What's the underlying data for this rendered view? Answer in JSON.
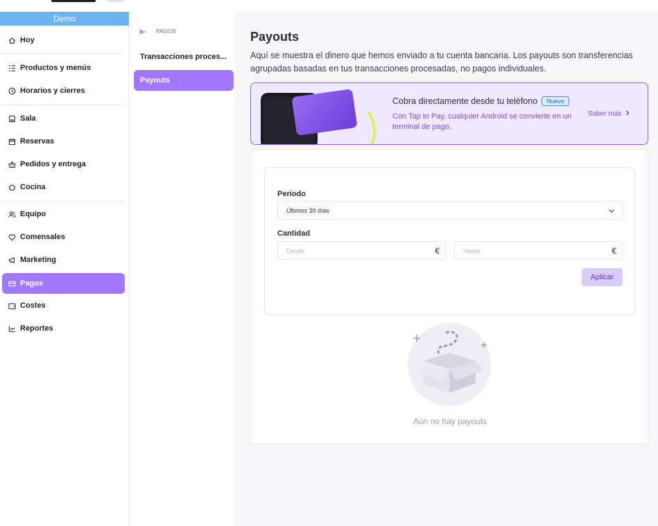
{
  "workspace": {
    "name": "Demo"
  },
  "sidebar": {
    "items": [
      {
        "label": "Hoy",
        "icon": "home-icon"
      },
      {
        "label": "Productos y menús",
        "icon": "list-icon"
      },
      {
        "label": "Horarios y cierres",
        "icon": "clock-icon"
      },
      {
        "label": "Sala",
        "icon": "store-icon"
      },
      {
        "label": "Reservas",
        "icon": "calendar-icon"
      },
      {
        "label": "Pedidos y entrega",
        "icon": "basket-icon"
      },
      {
        "label": "Cocina",
        "icon": "chef-hat-icon"
      },
      {
        "label": "Equipo",
        "icon": "team-icon"
      },
      {
        "label": "Comensales",
        "icon": "heart-icon"
      },
      {
        "label": "Marketing",
        "icon": "megaphone-icon"
      },
      {
        "label": "Pagos",
        "icon": "card-icon",
        "active": true
      },
      {
        "label": "Costes",
        "icon": "wallet-icon"
      },
      {
        "label": "Reportes",
        "icon": "chart-icon"
      }
    ]
  },
  "subnav": {
    "header": "PAGOS",
    "items": [
      {
        "label": "Transacciones proces..."
      },
      {
        "label": "Payouts",
        "active": true
      }
    ]
  },
  "main": {
    "title": "Payouts",
    "description": "Aquí se muestra el dinero que hemos enviado a tu cuenta bancaria. Los payouts son transferencias agrupadas basadas en tus transacciones procesadas, no pagos individuales.",
    "banner": {
      "title": "Cobra directamente desde tu teléfono",
      "badge": "Nuevo",
      "text": "Con Tap to Pay, cualquier Android se convierte en un terminal de pago.",
      "link": "Saber más"
    },
    "filters": {
      "period_label": "Periodo",
      "period_value": "Últimos 30 días",
      "amount_label": "Cantidad",
      "from_placeholder": "Desde",
      "to_placeholder": "Hasta",
      "currency": "€",
      "apply_label": "Aplicar"
    },
    "empty_text": "Aún no hay payouts"
  },
  "colors": {
    "accent": "#a178fb",
    "demo_bar": "#6cb4ef",
    "banner_bg": "#efe8ff"
  }
}
